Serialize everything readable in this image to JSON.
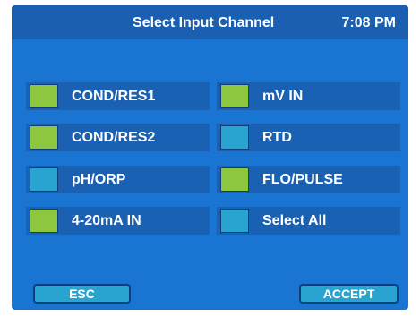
{
  "header": {
    "title": "Select Input Channel",
    "time": "7:08 PM"
  },
  "channels": [
    {
      "label": "COND/RES1",
      "selected": true
    },
    {
      "label": "mV IN",
      "selected": true
    },
    {
      "label": "COND/RES2",
      "selected": true
    },
    {
      "label": "RTD",
      "selected": false
    },
    {
      "label": "pH/ORP",
      "selected": false
    },
    {
      "label": "FLO/PULSE",
      "selected": true
    },
    {
      "label": "4-20mA IN",
      "selected": true
    },
    {
      "label": "Select All",
      "selected": false
    }
  ],
  "buttons": {
    "esc": "ESC",
    "accept": "ACCEPT"
  },
  "colors": {
    "background": "#1974d2",
    "header": "#1a5fb0",
    "row": "#1b61b3",
    "selected": "#8dc63f",
    "unselected": "#29a3cf"
  }
}
